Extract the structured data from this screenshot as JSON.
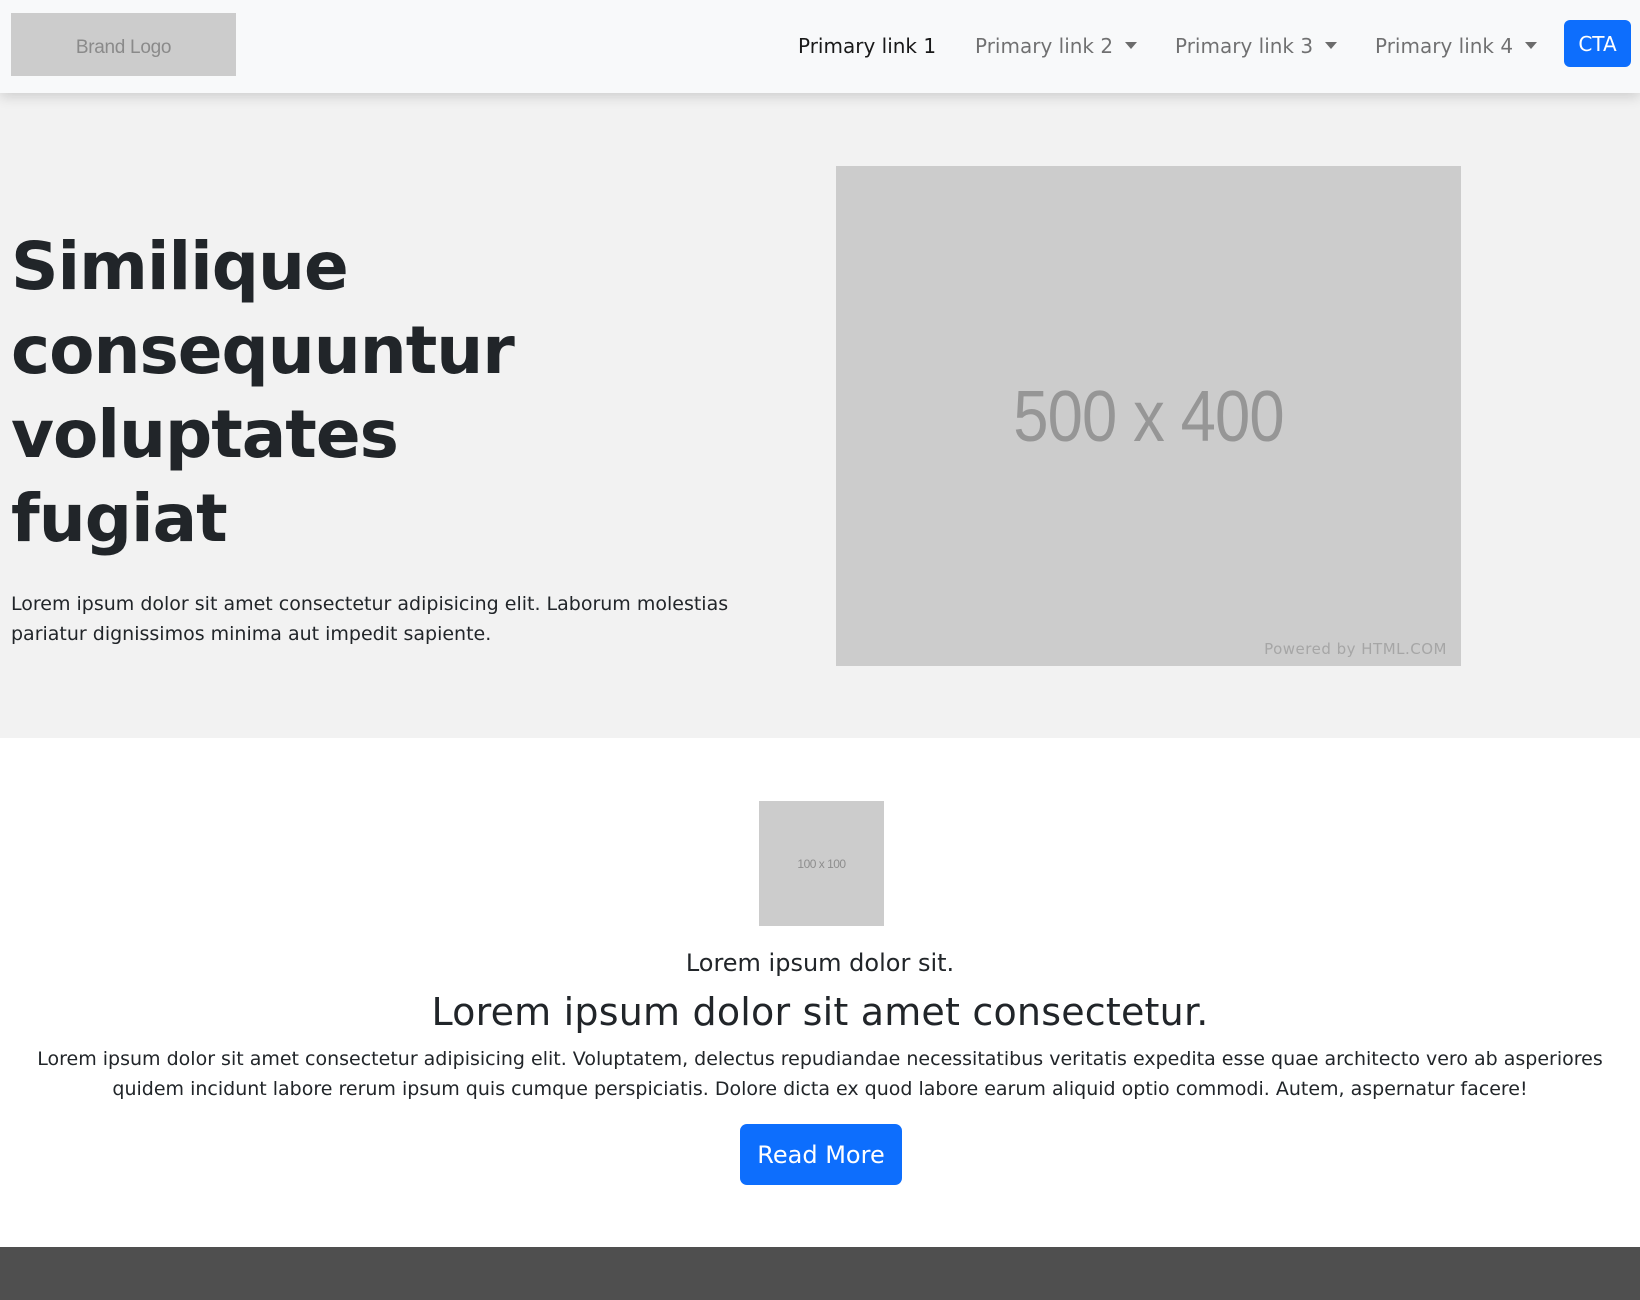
{
  "navbar": {
    "brand_logo": "Brand Logo",
    "links": [
      {
        "label": "Primary link 1",
        "dropdown": false,
        "active": true
      },
      {
        "label": "Primary link 2",
        "dropdown": true,
        "active": false
      },
      {
        "label": "Primary link 3",
        "dropdown": true,
        "active": false
      },
      {
        "label": "Primary link 4",
        "dropdown": true,
        "active": false
      }
    ],
    "cta_label": "CTA"
  },
  "hero": {
    "title": "Similique consequuntur voluptates fugiat",
    "text": "Lorem ipsum dolor sit amet consectetur adipisicing elit. Laborum molestias pariatur dignissimos minima aut impedit sapiente.",
    "image_label": "500 x 400",
    "image_credit": "Powered by HTML.COM"
  },
  "feature": {
    "thumb_label": "100 x 100",
    "eyebrow": "Lorem ipsum dolor sit.",
    "heading": "Lorem ipsum dolor sit amet consectetur.",
    "text": "Lorem ipsum dolor sit amet consectetur adipisicing elit. Voluptatem, delectus repudiandae necessitatibus veritatis expedita esse quae architecto vero ab asperiores quidem incidunt labore rerum ipsum quis cumque perspiciatis. Dolore dicta ex quod labore earum aliquid optio commodi. Autem, aspernatur facere!",
    "button_label": "Read More"
  },
  "colors": {
    "primary": "#0d6efd",
    "navbar_bg": "#f8f9fa",
    "hero_bg": "#f2f2f2",
    "placeholder_bg": "#cccccc",
    "footer_bg": "#4f4f4f",
    "text": "#212529"
  }
}
